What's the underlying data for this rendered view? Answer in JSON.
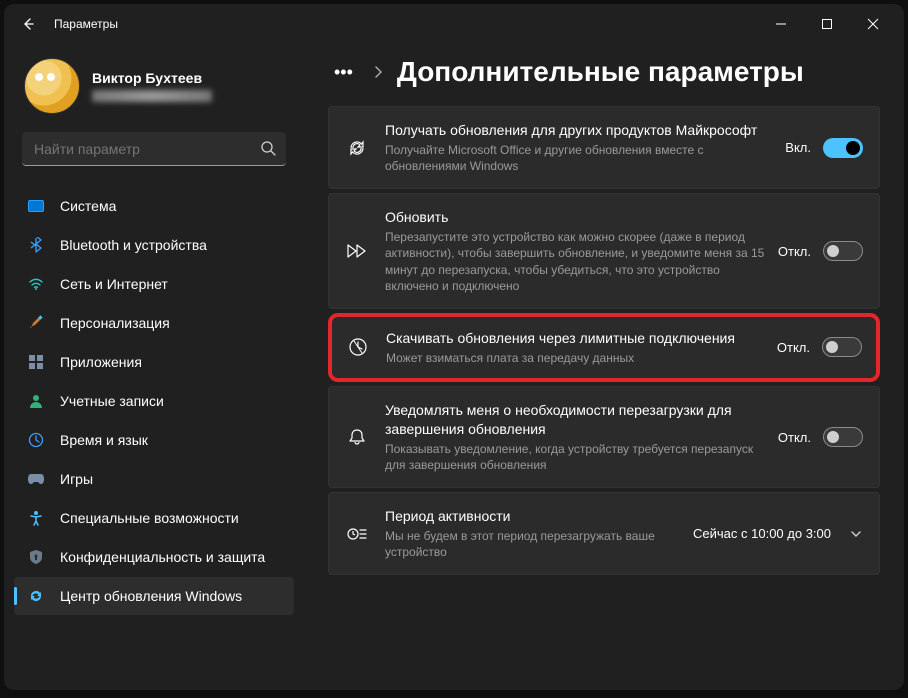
{
  "window": {
    "title": "Параметры"
  },
  "profile": {
    "name": "Виктор Бухтеев"
  },
  "search": {
    "placeholder": "Найти параметр"
  },
  "sidebar": {
    "items": [
      {
        "label": "Система"
      },
      {
        "label": "Bluetooth и устройства"
      },
      {
        "label": "Сеть и Интернет"
      },
      {
        "label": "Персонализация"
      },
      {
        "label": "Приложения"
      },
      {
        "label": "Учетные записи"
      },
      {
        "label": "Время и язык"
      },
      {
        "label": "Игры"
      },
      {
        "label": "Специальные возможности"
      },
      {
        "label": "Конфиденциальность и защита"
      },
      {
        "label": "Центр обновления Windows"
      }
    ]
  },
  "breadcrumb": {
    "title": "Дополнительные параметры"
  },
  "labels": {
    "on": "Вкл.",
    "off": "Откл."
  },
  "cards": [
    {
      "title": "Получать обновления для других продуктов Майкрософт",
      "desc": "Получайте Microsoft Office и другие обновления вместе с обновлениями Windows",
      "state_on": true
    },
    {
      "title": "Обновить",
      "desc": "Перезапустите это устройство как можно скорее (даже в период активности), чтобы завершить обновление, и уведомите меня за 15 минут до перезапуска, чтобы убедиться, что это устройство включено и подключено",
      "state_on": false
    },
    {
      "title": "Скачивать обновления через лимитные подключения",
      "desc": "Может взиматься плата за передачу данных",
      "state_on": false
    },
    {
      "title": "Уведомлять меня о необходимости перезагрузки для завершения обновления",
      "desc": "Показывать уведомление, когда устройству требуется перезапуск для завершения обновления",
      "state_on": false
    },
    {
      "title": "Период активности",
      "desc": "Мы не будем в этот период перезагружать ваше устройство",
      "value": "Сейчас с 10:00 до 3:00"
    }
  ]
}
